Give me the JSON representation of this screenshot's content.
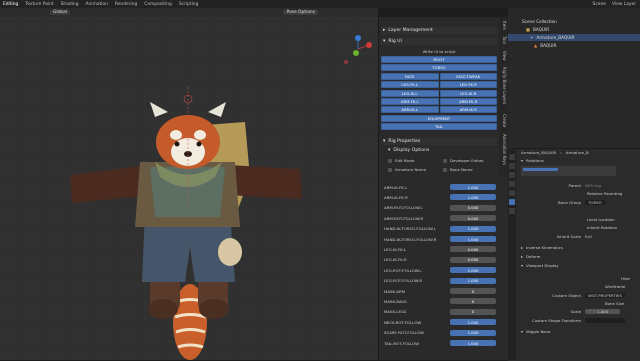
{
  "topbar": {
    "menus": [
      "Editing",
      "Texture Paint",
      "Shading",
      "Animation",
      "Rendering",
      "Compositing",
      "Scripting"
    ],
    "active_index": 0,
    "scene": "Scene",
    "view_layer": "View Layer"
  },
  "viewport": {
    "orientation": "Global",
    "pose_options": "Pose Options"
  },
  "npanel": {
    "tabs": [
      "Item",
      "Tool",
      "View",
      "Rigify Bone Layers",
      "Create",
      "Animation Keys"
    ],
    "layer_management": "Layer Management",
    "rig_ui": "Rig UI",
    "write_ui": "Write UI to script",
    "rig_buttons": [
      [
        "ROOT"
      ],
      [
        "TORSO"
      ],
      [
        "FACE",
        "FACE-TWEAK"
      ],
      [
        "LEG.FK.L",
        "LEG.FK.R"
      ],
      [
        "LEG.IK.L",
        "LEG.IK.R"
      ],
      [
        "ARM.FK.L",
        "ARM.FK.R"
      ],
      [
        "ARM.IK.L",
        "ARM.IK.R"
      ],
      [
        "EQUIPMENT"
      ],
      [
        "TAIL"
      ]
    ],
    "rig_properties": "Rig Properties",
    "display_options": "Display Options",
    "checks": [
      {
        "label": "Edit Mode",
        "checked": false
      },
      {
        "label": "Developer Extras",
        "checked": false
      },
      {
        "label": "Armature Name",
        "checked": false
      },
      {
        "label": "Bone Name",
        "checked": false
      }
    ],
    "props": [
      {
        "label": "ARM-IK.FK.L",
        "value": "1.000",
        "on": true
      },
      {
        "label": "ARM-IK.FK.R",
        "value": "1.000",
        "on": true
      },
      {
        "label": "ARM-ROT-FOLLOW.L",
        "value": "0.000",
        "on": false
      },
      {
        "label": "ARM-ROT-FOLLOW.R",
        "value": "0.000",
        "on": false
      },
      {
        "label": "HAND-IK-TORSO-FOLLOW.L",
        "value": "1.000",
        "on": true
      },
      {
        "label": "HAND-IK-TORSO-FOLLOW.R",
        "value": "1.000",
        "on": true
      },
      {
        "label": "LEG-IK.FK.L",
        "value": "0.000",
        "on": false
      },
      {
        "label": "LEG-IK.FK.R",
        "value": "0.000",
        "on": false
      },
      {
        "label": "LEG-ROT-FOLLOW.L",
        "value": "1.000",
        "on": true
      },
      {
        "label": "LEG-ROT-FOLLOW.R",
        "value": "1.000",
        "on": true
      },
      {
        "label": "MASK.ARM",
        "value": "0",
        "on": false
      },
      {
        "label": "MASK.BACK",
        "value": "0",
        "on": false
      },
      {
        "label": "MASK.LEGS",
        "value": "0",
        "on": false
      },
      {
        "label": "NECK-ROT-FOLLOW",
        "value": "1.000",
        "on": true
      },
      {
        "label": "SCARF-ROT-FOLLOW",
        "value": "1.000",
        "on": true
      },
      {
        "label": "TAIL-ROT-FOLLOW",
        "value": "1.000",
        "on": true
      }
    ]
  },
  "outliner": {
    "collection": "Scene Collection",
    "rows": [
      "BAQUIR",
      "Armature_BAQUIR",
      "BAQUIR"
    ]
  },
  "properties": {
    "breadcrumb_obj": "Armature_BAQUIR",
    "breadcrumb_bone": "Armature_B",
    "relations": "Relations",
    "parent_label": "Parent",
    "parent_value": "DEF.ring",
    "relative_parenting": "Relative Parenting",
    "bone_group_label": "Bone Group",
    "bone_group_value": "TORSO",
    "local_location": "Local Location",
    "inherit_rotation": "Inherit Rotation",
    "inherit_scale_label": "Inherit Scale",
    "inherit_scale_value": "Full",
    "inverse_kinematics": "Inverse Kinematics",
    "deform": "Deform",
    "viewport_display": "Viewport Display",
    "hide": "Hide",
    "wireframe": "Wireframe",
    "custom_object_label": "Custom Object",
    "custom_object_value": "WGT-PROPERTIES",
    "bone_size": "Bone Size",
    "scale_label": "Scale",
    "scale_value": "1.000",
    "custom_shape_transform": "Custom Shape Transform",
    "wiggle_bone": "Wiggle Bone"
  },
  "colors": {
    "accent": "#4772b3",
    "viewport_bg": "#303030",
    "panel_bg": "#2a2a2a"
  }
}
